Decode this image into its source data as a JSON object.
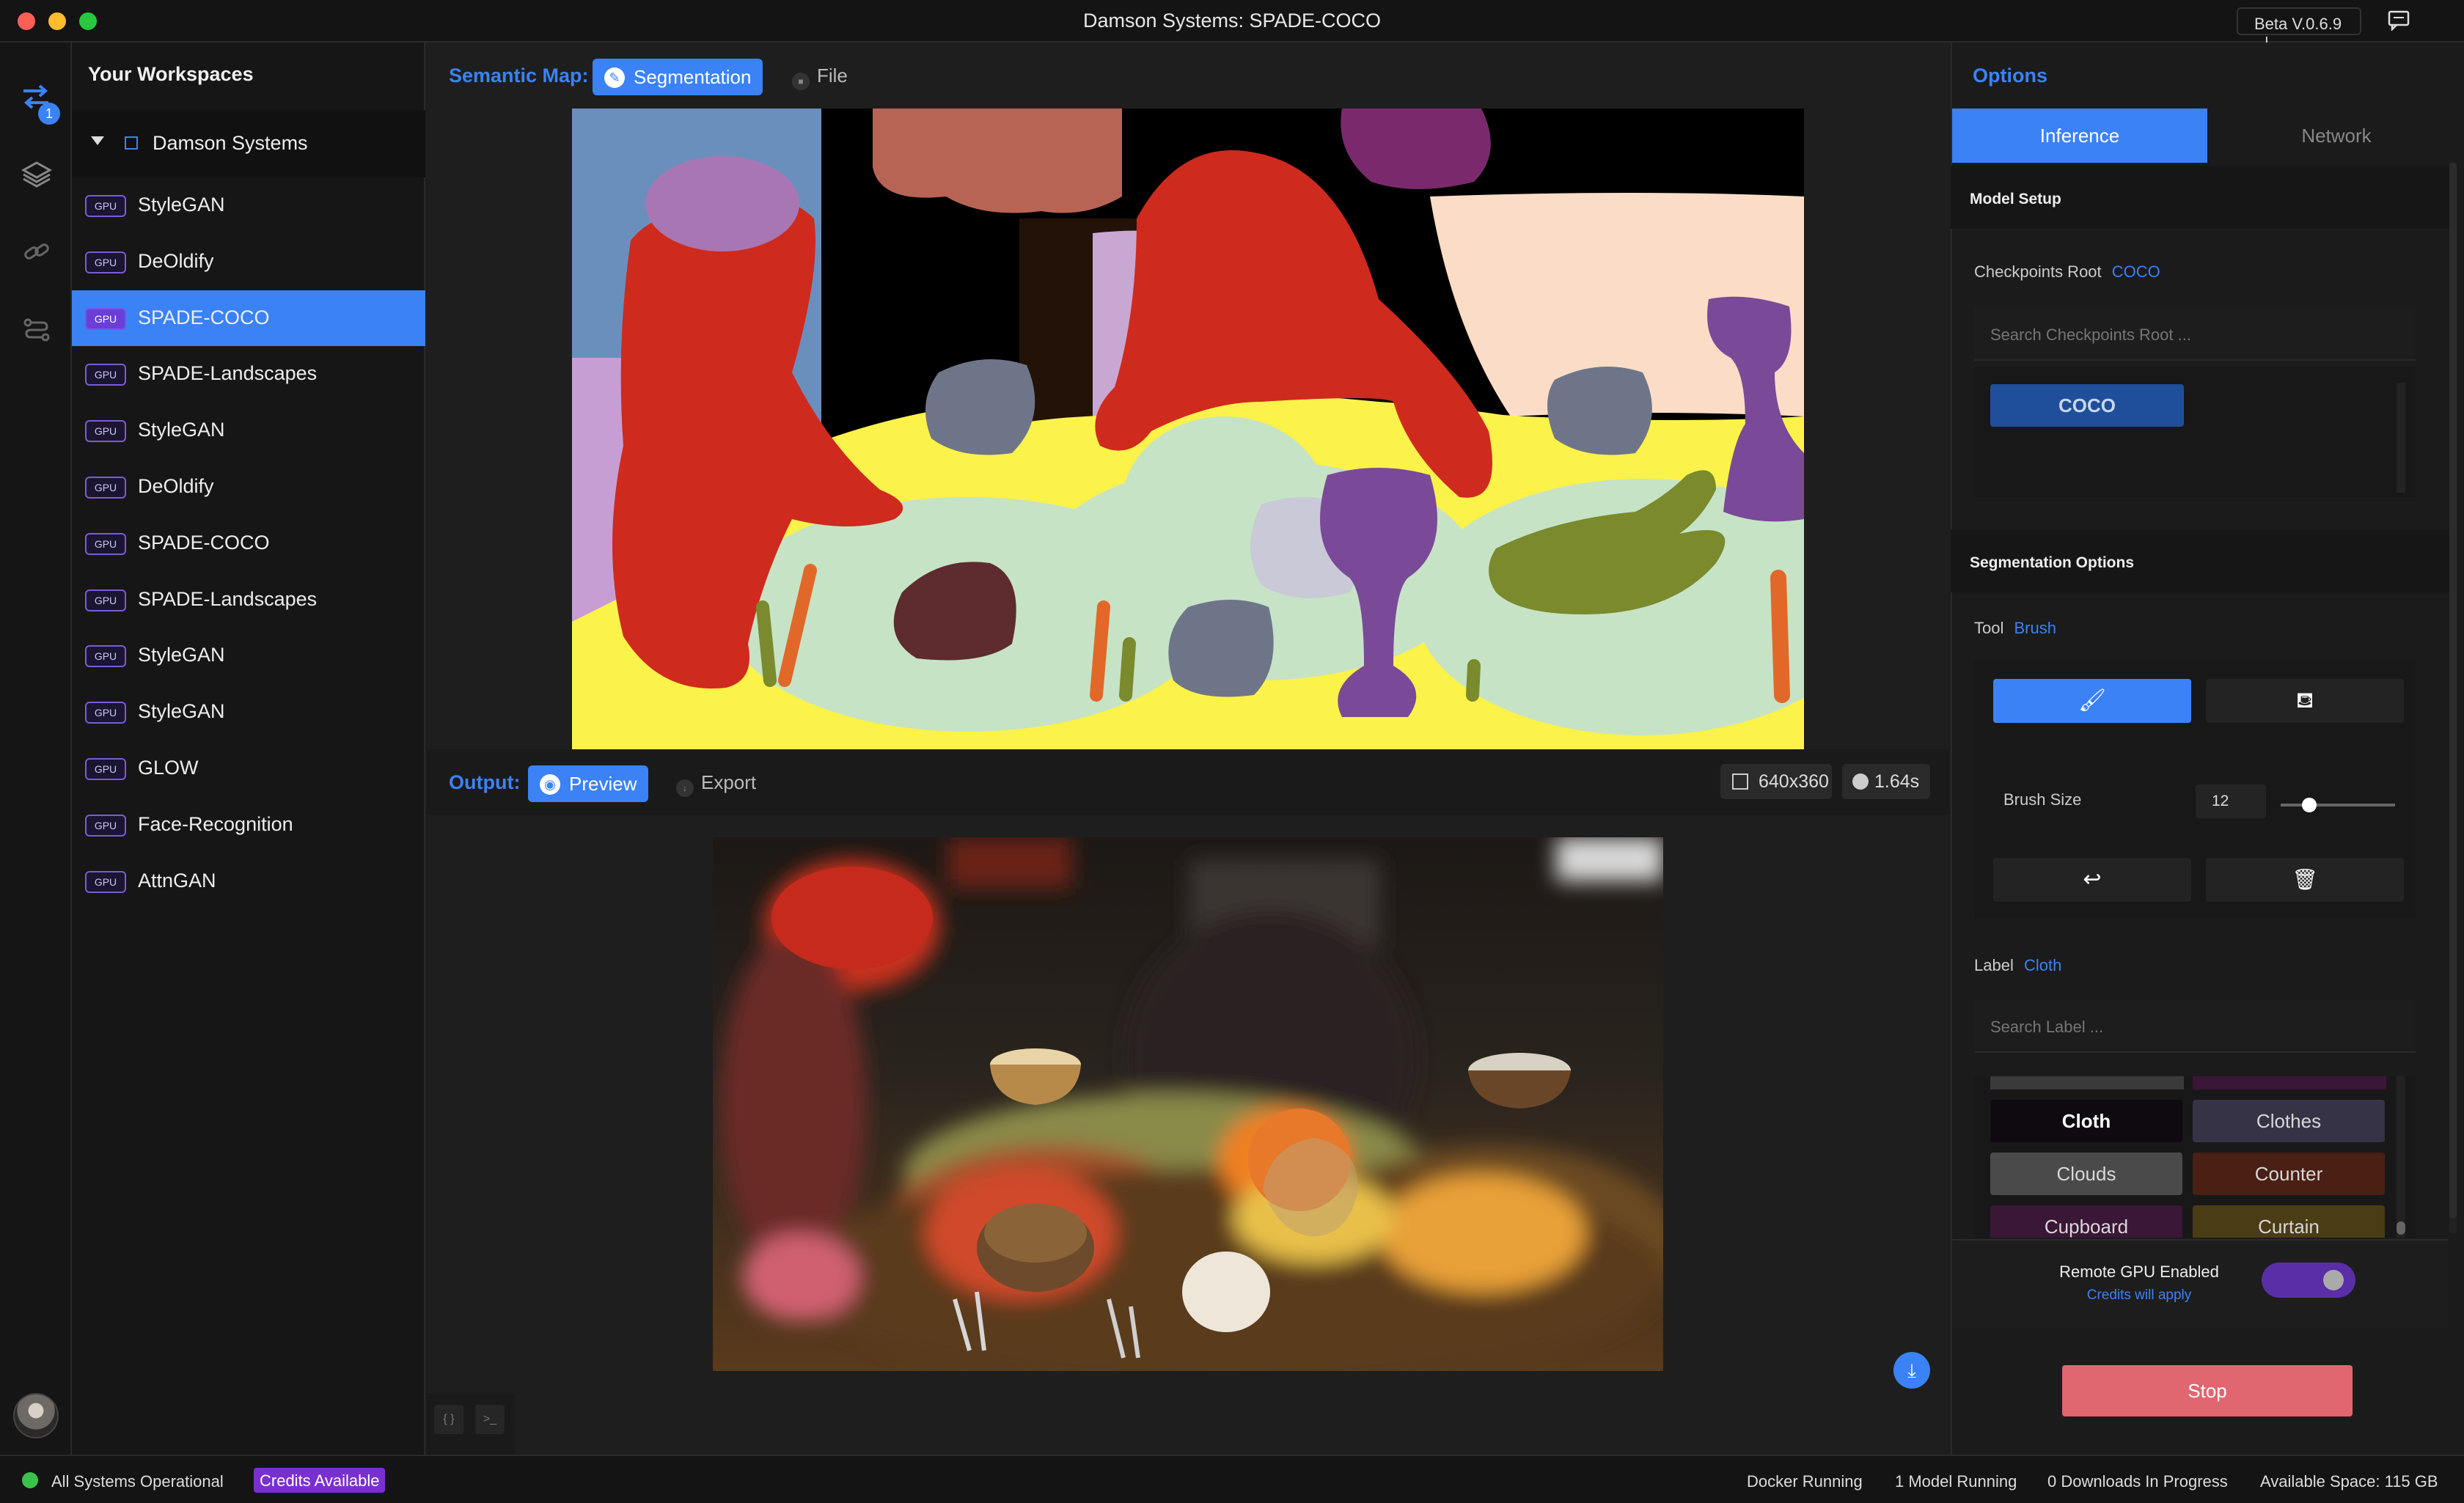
{
  "window": {
    "title": "Damson Systems: SPADE-COCO",
    "version": "Beta V.0.6.9"
  },
  "rail": {
    "badge_count": "1"
  },
  "sidebar": {
    "title": "Your Workspaces",
    "group": "Damson Systems",
    "gpu_tag": "GPU",
    "items": [
      {
        "label": "StyleGAN"
      },
      {
        "label": "DeOldify"
      },
      {
        "label": "SPADE-COCO",
        "active": true
      },
      {
        "label": "SPADE-Landscapes"
      },
      {
        "label": "StyleGAN"
      },
      {
        "label": "DeOldify"
      },
      {
        "label": "SPADE-COCO"
      },
      {
        "label": "SPADE-Landscapes"
      },
      {
        "label": "StyleGAN"
      },
      {
        "label": "StyleGAN"
      },
      {
        "label": "GLOW"
      },
      {
        "label": "Face-Recognition"
      },
      {
        "label": "AttnGAN"
      }
    ]
  },
  "semantic_map": {
    "label": "Semantic Map:",
    "tab_segmentation": "Segmentation",
    "tab_file": "File"
  },
  "output": {
    "label": "Output:",
    "tab_preview": "Preview",
    "tab_export": "Export",
    "resolution": "640x360",
    "time": "1.64s"
  },
  "options": {
    "title": "Options",
    "tab_inference": "Inference",
    "tab_network": "Network",
    "model_setup": "Model Setup",
    "checkpoints_label": "Checkpoints Root",
    "checkpoints_value": "COCO",
    "checkpoints_search_placeholder": "Search Checkpoints Root ...",
    "checkpoint_item": "COCO",
    "segmentation_options": "Segmentation Options",
    "tool_label": "Tool",
    "tool_value": "Brush",
    "brush_size_label": "Brush Size",
    "brush_size_value": "12",
    "brush_size_level": 0.25,
    "label_label": "Label",
    "label_value": "Cloth",
    "label_search_placeholder": "Search Label ...",
    "labels": [
      {
        "text": "Cloth",
        "bg": "#0e0a10",
        "selected": true
      },
      {
        "text": "Clothes",
        "bg": "#363346"
      },
      {
        "text": "Clouds",
        "bg": "#4a4a4a"
      },
      {
        "text": "Counter",
        "bg": "#4a1f14"
      },
      {
        "text": "Cupboard",
        "bg": "#3a1637"
      },
      {
        "text": "Curtain",
        "bg": "#4a3c14"
      }
    ],
    "remote_gpu_label": "Remote GPU Enabled",
    "remote_gpu_sub": "Credits will apply",
    "remote_gpu_enabled": true,
    "stop_label": "Stop"
  },
  "statusbar": {
    "systems": "All Systems Operational",
    "credits": "Credits Available",
    "docker": "Docker Running",
    "models": "1 Model Running",
    "downloads": "0 Downloads In Progress",
    "space": "Available Space: 115 GB"
  },
  "colors": {
    "accent": "#3a82f6",
    "stop": "#e06670",
    "gpu_purple": "#6a3fd8",
    "ok_green": "#3ac24a",
    "credits_purple": "#7a2fd0"
  }
}
